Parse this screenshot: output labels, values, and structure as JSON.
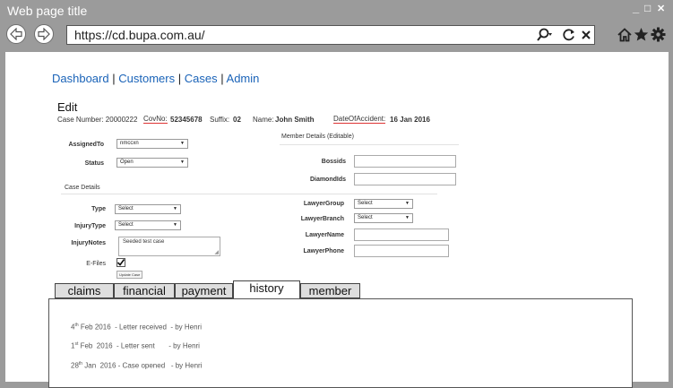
{
  "window": {
    "title": "Web page title",
    "controls": {
      "minimize": "_",
      "maximize": "□",
      "close": "✕"
    }
  },
  "browser": {
    "url": "https://cd.bupa.com.au/"
  },
  "nav": {
    "dashboard": "Dashboard",
    "customers": "Customers",
    "cases": "Cases",
    "admin": "Admin",
    "separator": "|"
  },
  "edit": {
    "title": "Edit",
    "case_number": "Case Number: 20000222",
    "cov_label": "CovNo:",
    "cov_value": "52345678",
    "suffix_label": "Suffix:",
    "suffix_value": "02",
    "name_label": "Name:",
    "name_value": "John Smith",
    "doa_label": "DateOfAccident:",
    "doa_value": "16 Jan 2016"
  },
  "form": {
    "member_details_header": "Member Details (Editable)",
    "assigned_to_label": "AssignedTo",
    "assigned_to_value": "nmccxn",
    "status_label": "Status",
    "status_value": "Open",
    "bossids_label": "Bossids",
    "diamondids_label": "DiamondIds",
    "case_details_header": "Case Details",
    "type_label": "Type",
    "type_value": "Select",
    "injury_type_label": "InjuryType",
    "injury_type_value": "Select",
    "injury_notes_label": "InjuryNotes",
    "injury_notes_value": "Seeded test case",
    "efiles_label": "E-Files",
    "update_case_label": "Update Case",
    "lawyer_group_label": "LawyerGroup",
    "lawyer_group_value": "Select",
    "lawyer_branch_label": "LawyerBranch",
    "lawyer_branch_value": "Select",
    "lawyer_name_label": "LawyerName",
    "lawyer_phone_label": "LawyerPhone"
  },
  "tabs": [
    {
      "label": "claims",
      "active": false
    },
    {
      "label": "financial",
      "active": false
    },
    {
      "label": "payment",
      "active": false
    },
    {
      "label": "history",
      "active": true
    },
    {
      "label": "member",
      "active": false
    }
  ],
  "history": [
    {
      "day": "4",
      "sup": "th",
      "rest": " Feb 2016  - Letter received  - by Henri"
    },
    {
      "day": "1",
      "sup": "st",
      "rest": " Feb  2016  - Letter sent       - by Henri"
    },
    {
      "day": "28",
      "sup": "th",
      "rest": " Jan  2016 - Case opened   - by Henri"
    }
  ],
  "icons": [
    "back-arrow-icon",
    "forward-arrow-icon",
    "search-icon",
    "refresh-icon",
    "close-icon",
    "home-icon",
    "star-icon",
    "gear-icon"
  ]
}
